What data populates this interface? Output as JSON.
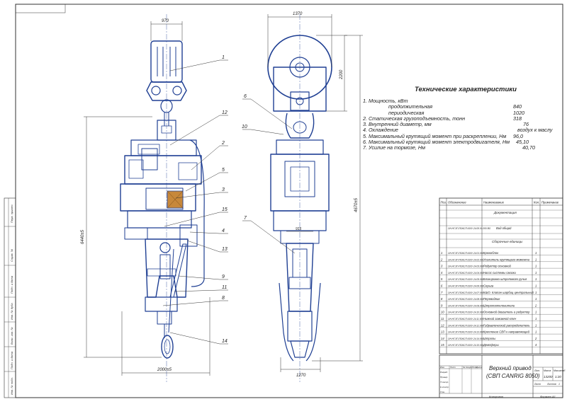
{
  "dimensions": {
    "left_top_width": "970",
    "right_top_width": "1370",
    "right_height": "2200",
    "left_total_height": "6440±5",
    "right_total_height": "4670±5",
    "left_bottom_width": "2000±5",
    "right_bottom_width": "1270",
    "right_mid_width": "915"
  },
  "callouts_left": [
    "1",
    "12",
    "2",
    "5",
    "3",
    "15",
    "4",
    "13",
    "9",
    "11",
    "8",
    "14"
  ],
  "callouts_right": [
    "6",
    "10",
    "7"
  ],
  "specs": {
    "title": "Технические характеристики",
    "lines": [
      {
        "text": "1. Мощность, кВт",
        "value": ""
      },
      {
        "text": "продолжительная",
        "value": "840"
      },
      {
        "text": "периодическая",
        "value": "1020"
      },
      {
        "text": "2. Статическая грузоподъемность, тонн",
        "value": "318"
      },
      {
        "text": "3. Внутренний диаметр, мм",
        "value": "76"
      },
      {
        "text": "4. Охлаждение",
        "value": "воздух к маслу"
      },
      {
        "text": "5. Максимальный крутящий момент при раскреплении, Нм",
        "value": "96,0"
      },
      {
        "text": "6. Максимальный крутящий момент электродвигателя, Нм",
        "value": "45,10"
      },
      {
        "text": "7. Усилие на тормозе, Нм",
        "value": "40,70"
      }
    ]
  },
  "bom": {
    "headers": [
      "Поз.",
      "Обозначение",
      "Наименование",
      "Кол.",
      "Примечание"
    ],
    "section_doc": "Документация",
    "doc_row": {
      "code": "ОН.НГ.ЗП-ПО6СП.610У-24.00.01.000 ВО",
      "name": "Вид общий"
    },
    "section_units": "Сборочные единицы",
    "rows": [
      {
        "pos": "1",
        "code": "ОН.НГ.ЗП-ПО6СП.610У-24.01.000",
        "name": "Крюкоблок",
        "qty": "1"
      },
      {
        "pos": "2",
        "code": "ОН.НГ.ЗП-ПО6СП.610У-24.02.000",
        "name": "Усилитель крутящего момента",
        "qty": "1"
      },
      {
        "pos": "3",
        "code": "ОН.НГ.ЗП-ПО6СП.610У-24.03.000",
        "name": "Редуктор основной",
        "qty": "1"
      },
      {
        "pos": "4",
        "code": "ОН.НГ.ЗП-ПО6СП.610У-24.04.000",
        "name": "Насос системы смазки",
        "qty": "1"
      },
      {
        "pos": "5",
        "code": "ОН.НГ.ЗП-ПО6СП.610У-24.05.000",
        "name": "Блокировка штропового ручья",
        "qty": "1"
      },
      {
        "pos": "6",
        "code": "ОН.НГ.ЗП-ПО6СП.610У-24.06.000",
        "name": "Серьга",
        "qty": "1"
      },
      {
        "pos": "7",
        "code": "ОН.НГ.ЗП-ПО6СП.610У-24.07.000",
        "name": "КШО. Клапан шарбиц центральный",
        "qty": "1"
      },
      {
        "pos": "8",
        "code": "ОН.НГ.ЗП-ПО6СП.610У-24.08.000",
        "name": "Переводник",
        "qty": "1"
      },
      {
        "pos": "9",
        "code": "ОН.НГ.ЗП-ПО6СП.610У-24.09.000",
        "name": "Штропоотклонители",
        "qty": "2"
      },
      {
        "pos": "10",
        "code": "ОН.НГ.ЗП-ПО6СП.610У-24.10.000",
        "name": "Основной двигатель и редуктор",
        "qty": "1"
      },
      {
        "pos": "11",
        "code": "ОН.НГ.ЗП-ПО6СП.610У-24.11.000",
        "name": "Нижний зажимной ключ",
        "qty": "1"
      },
      {
        "pos": "12",
        "code": "ОН.НГ.ЗП-ПО6СП.610У-24.12.000",
        "name": "Гидравлический распределитель",
        "qty": "1"
      },
      {
        "pos": "13",
        "code": "ОН.НГ.ЗП-ПО6СП.610У-24.13.000",
        "name": "Крепление СВП к направляющей",
        "qty": "1"
      },
      {
        "pos": "14",
        "code": "ОН.НГ.ЗП-ПО6СП.610У-24.14.000",
        "name": "Штропы",
        "qty": "2"
      },
      {
        "pos": "15",
        "code": "ОН.НГ.ЗП-ПО6СП.610У-24.15.000",
        "name": "Демпферы",
        "qty": "4"
      }
    ]
  },
  "title_block": {
    "title_line1": "Верхний привод",
    "title_line2": "(СВП CANRIG 8050)",
    "lit_label": "Лит.",
    "mass_label": "Масса",
    "scale_label": "Масштаб",
    "mass_value": "13200",
    "scale_value": "1:20",
    "sheet_label": "Лист",
    "sheets_label": "Листов",
    "sheets_value": "1",
    "copied": "Копировал",
    "format": "Формат А1",
    "rows": [
      "Изм.",
      "Лист",
      "№ докум.",
      "Подп.",
      "Дата"
    ],
    "roles": [
      "Разраб.",
      "Провер.",
      "Т.контр.",
      "Н.контр.",
      "Утв."
    ]
  },
  "side_stamps": [
    "Перв. примен.",
    "Справ. №",
    "Подп. и дата",
    "Инв. № дубл.",
    "Взам. инв. №",
    "Подп. и дата",
    "Инв. № подл."
  ]
}
